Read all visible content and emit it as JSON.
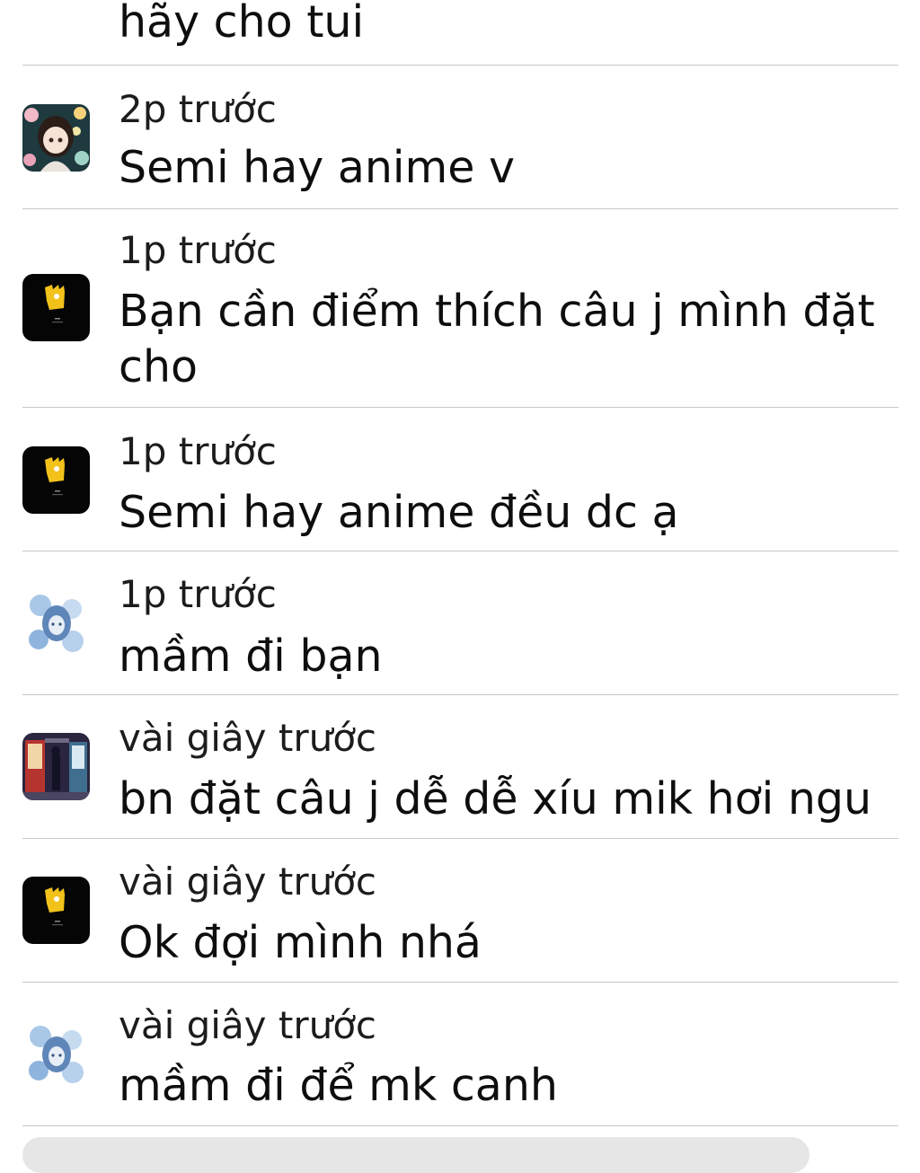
{
  "top_message": "hãy cho tui",
  "comments": [
    {
      "avatar": "anime-flower-girl-avatar",
      "time": "2p trước",
      "text": "Semi hay anime v"
    },
    {
      "avatar": "yellow-character-black-avatar",
      "time": "1p trước",
      "text": "Bạn cần điểm thích câu j mình đặt cho"
    },
    {
      "avatar": "yellow-character-black-avatar",
      "time": "1p trước",
      "text": "Semi hay anime đều dc ạ"
    },
    {
      "avatar": "blue-flower-girl-avatar",
      "time": "1p trước",
      "text": "mầm đi bạn"
    },
    {
      "avatar": "vending-machine-night-avatar",
      "time": "vài giây trước",
      "text": "bn đặt câu j dễ dễ xíu mik hơi ngu"
    },
    {
      "avatar": "yellow-character-black-avatar",
      "time": "vài giây trước",
      "text": "Ok đợi mình nhá"
    },
    {
      "avatar": "blue-flower-girl-avatar",
      "time": "vài giây trước",
      "text": "mầm đi để mk canh"
    }
  ]
}
